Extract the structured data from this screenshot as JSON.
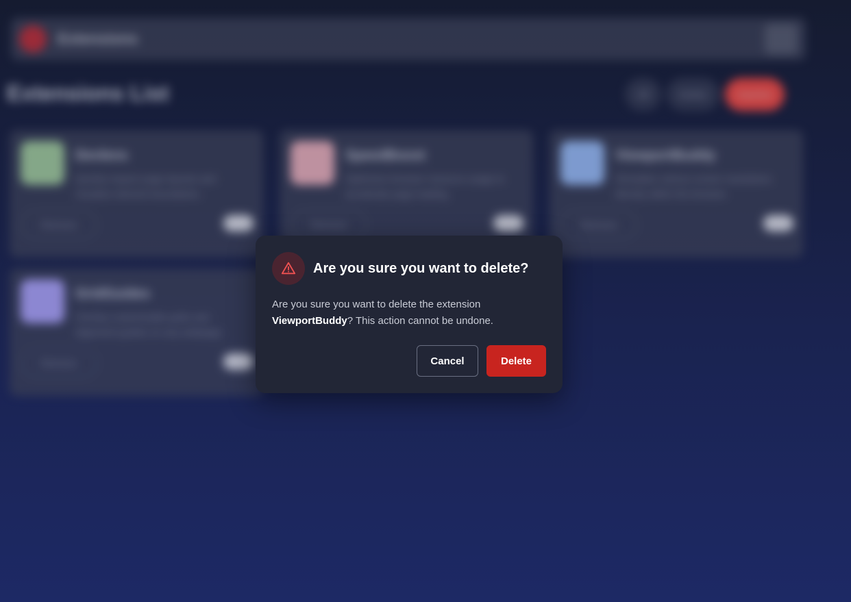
{
  "app": {
    "title": "Extensions",
    "list_title": "Extensions List",
    "filters": [
      "All",
      "Active",
      "Inactive"
    ]
  },
  "cards": [
    {
      "name": "Devlens",
      "description": "Quickly inspect page layouts and visualize element boundaries.",
      "remove_label": "Remove",
      "icon_color": "#a9d5a0",
      "icon": "devlens-icon"
    },
    {
      "name": "SpeedBoost",
      "description": "Optimizes browser resource usage to accelerate page loading.",
      "remove_label": "Remove",
      "icon_color": "#f6b7c0",
      "icon": "speedboost-icon"
    },
    {
      "name": "ViewportBuddy",
      "description": "Simulates various screen resolutions directly within the browser.",
      "remove_label": "Remove",
      "icon_color": "#9fc4ff",
      "icon": "viewportbuddy-icon"
    },
    {
      "name": "GridGuides",
      "description": "Overlay customizable grids and alignment guides on any webpage.",
      "remove_label": "Remove",
      "icon_color": "#b3a9ff",
      "icon": "gridguides-icon"
    }
  ],
  "dialog": {
    "title": "Are you sure you want to delete?",
    "body_prefix": "Are you sure you want to delete the extension",
    "extension_name": "ViewportBuddy",
    "body_suffix": "? This action cannot be undone.",
    "cancel_label": "Cancel",
    "delete_label": "Delete",
    "icon": "warning-icon"
  },
  "colors": {
    "danger": "#c8241f",
    "warning_icon": "#f05252",
    "dialog_bg": "#222636"
  }
}
